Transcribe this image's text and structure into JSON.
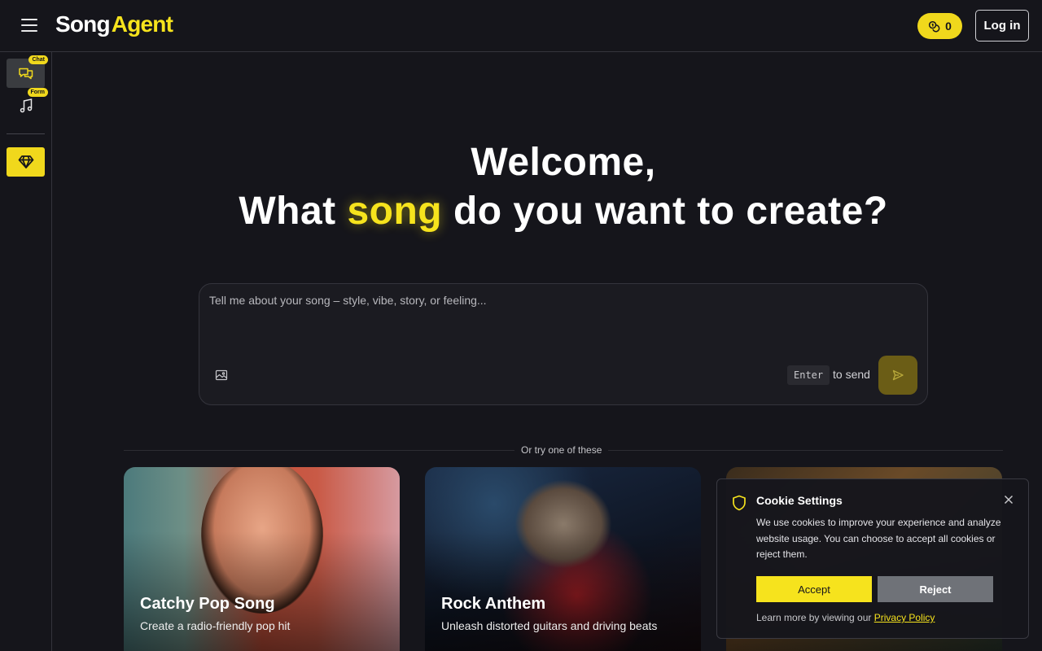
{
  "header": {
    "logo_part1": "Song",
    "logo_part2": "Agent",
    "credits": "0",
    "login_label": "Log in"
  },
  "sidebar": {
    "chat_badge": "Chat",
    "form_badge": "Form"
  },
  "hero": {
    "line1": "Welcome,",
    "line2_before": "What ",
    "line2_highlight": "song",
    "line2_after": " do you want to create?"
  },
  "prompt": {
    "placeholder": "Tell me about your song – style, vibe, story, or feeling...",
    "enter_key": "Enter",
    "to_send": "to send"
  },
  "suggestions": {
    "divider": "Or try one of these",
    "cards": [
      {
        "title": "Catchy Pop Song",
        "subtitle": "Create a radio-friendly pop hit"
      },
      {
        "title": "Rock Anthem",
        "subtitle": "Unleash distorted guitars and driving beats"
      }
    ]
  },
  "cookie": {
    "title": "Cookie Settings",
    "text": "We use cookies to improve your experience and analyze website usage. You can choose to accept all cookies or reject them.",
    "accept": "Accept",
    "reject": "Reject",
    "foot_text": "Learn more by viewing our ",
    "policy_link": "Privacy Policy"
  },
  "colors": {
    "accent": "#f6e31d",
    "background": "#15151b",
    "border": "#34343c"
  }
}
